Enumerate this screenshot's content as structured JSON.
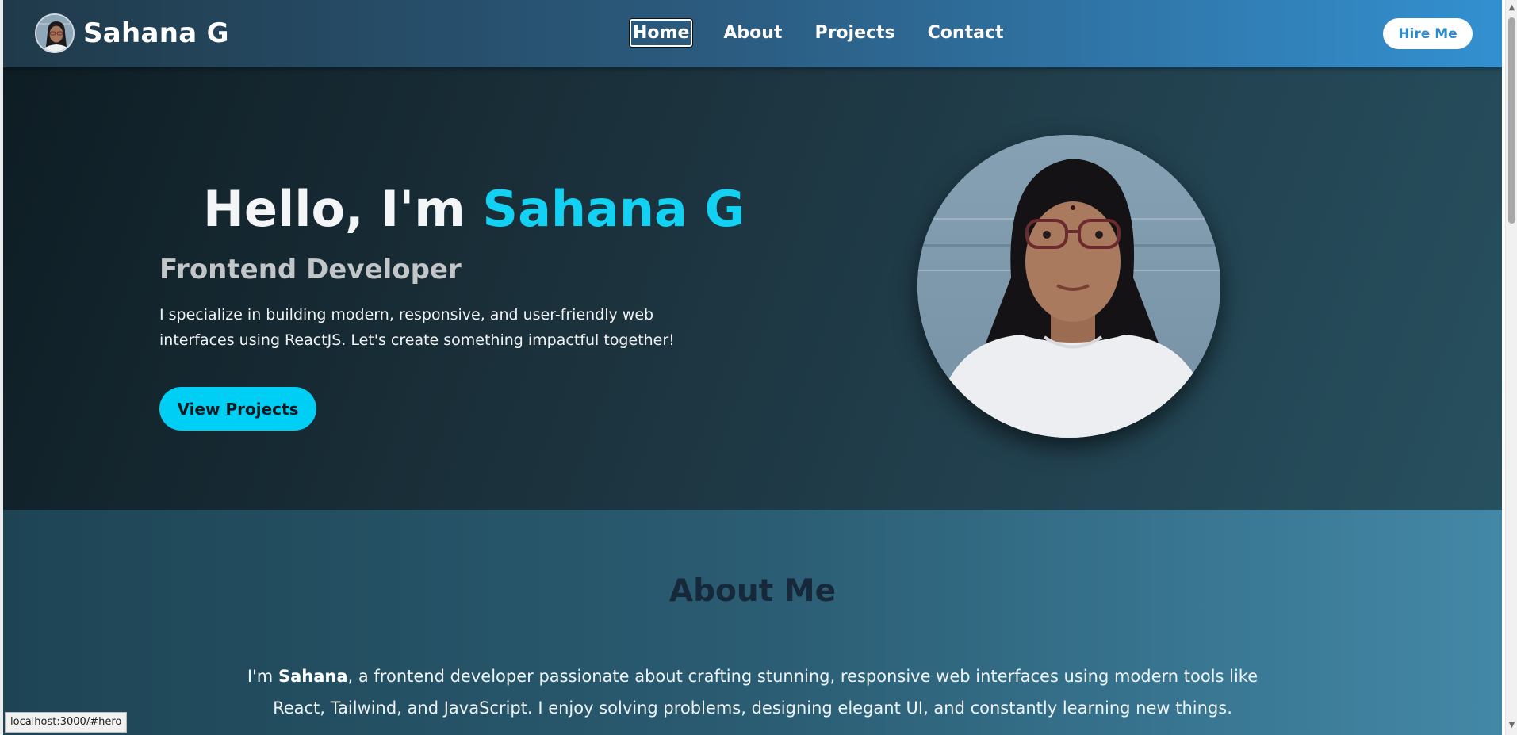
{
  "brand": {
    "name": "Sahana G"
  },
  "nav": {
    "items": [
      {
        "label": "Home",
        "active": true
      },
      {
        "label": "About",
        "active": false
      },
      {
        "label": "Projects",
        "active": false
      },
      {
        "label": "Contact",
        "active": false
      }
    ],
    "hire_label": "Hire Me"
  },
  "hero": {
    "greeting": "Hello, I'm",
    "name": "Sahana G",
    "role": "Frontend Developer",
    "description": "I specialize in building modern, responsive, and user-friendly web interfaces using ReactJS. Let's create something impactful together!",
    "cta_label": "View Projects"
  },
  "about": {
    "title": "About Me",
    "intro": "I'm",
    "name": "Sahana",
    "body": ", a frontend developer passionate about crafting stunning, responsive web interfaces using modern tools like React, Tailwind, and JavaScript. I enjoy solving problems, designing elegant UI, and constantly learning new things."
  },
  "status": {
    "url": "localhost:3000/#hero"
  },
  "colors": {
    "accent": "#13d1f2",
    "cta_bg": "#00cff5",
    "nav_start": "#203a4a",
    "nav_end": "#3390d0",
    "hire_text": "#2f8bc9"
  },
  "icons": {
    "scroll_up": "scroll-up-arrow",
    "scroll_down": "scroll-down-arrow"
  }
}
